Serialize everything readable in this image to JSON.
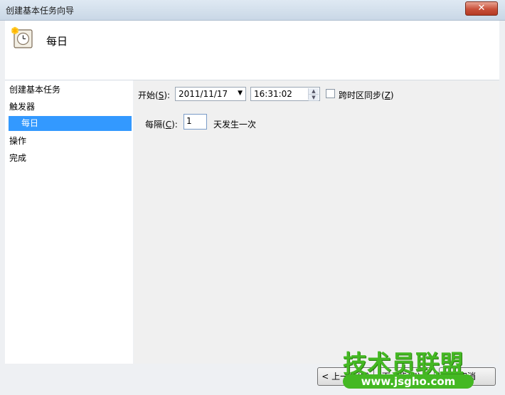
{
  "window": {
    "title": "创建基本任务向导",
    "close_symbol": "✕"
  },
  "header": {
    "title": "每日",
    "icon": "clock-calendar-icon"
  },
  "nav": {
    "items": [
      {
        "label": "创建基本任务"
      },
      {
        "label": "触发器"
      },
      {
        "label": "每日"
      },
      {
        "label": "操作"
      },
      {
        "label": "完成"
      }
    ]
  },
  "form": {
    "start_label_prefix": "开始(",
    "start_label_key": "S",
    "start_label_suffix": "):",
    "start_date": "2011/11/17",
    "start_time": "16:31:02",
    "sync_label_prefix": "跨时区同步(",
    "sync_label_key": "Z",
    "sync_label_suffix": ")",
    "sync_checked": false,
    "recur_label_prefix": "每隔(",
    "recur_label_key": "C",
    "recur_label_suffix": "):",
    "recur_value": "1",
    "recur_unit": "天发生一次"
  },
  "footer": {
    "back_label": "< 上一步(B)",
    "next_label": "下一步(N) >",
    "cancel_label": "取消"
  },
  "watermark": {
    "main": "技术员联盟",
    "url": "www.jsgho.com"
  }
}
